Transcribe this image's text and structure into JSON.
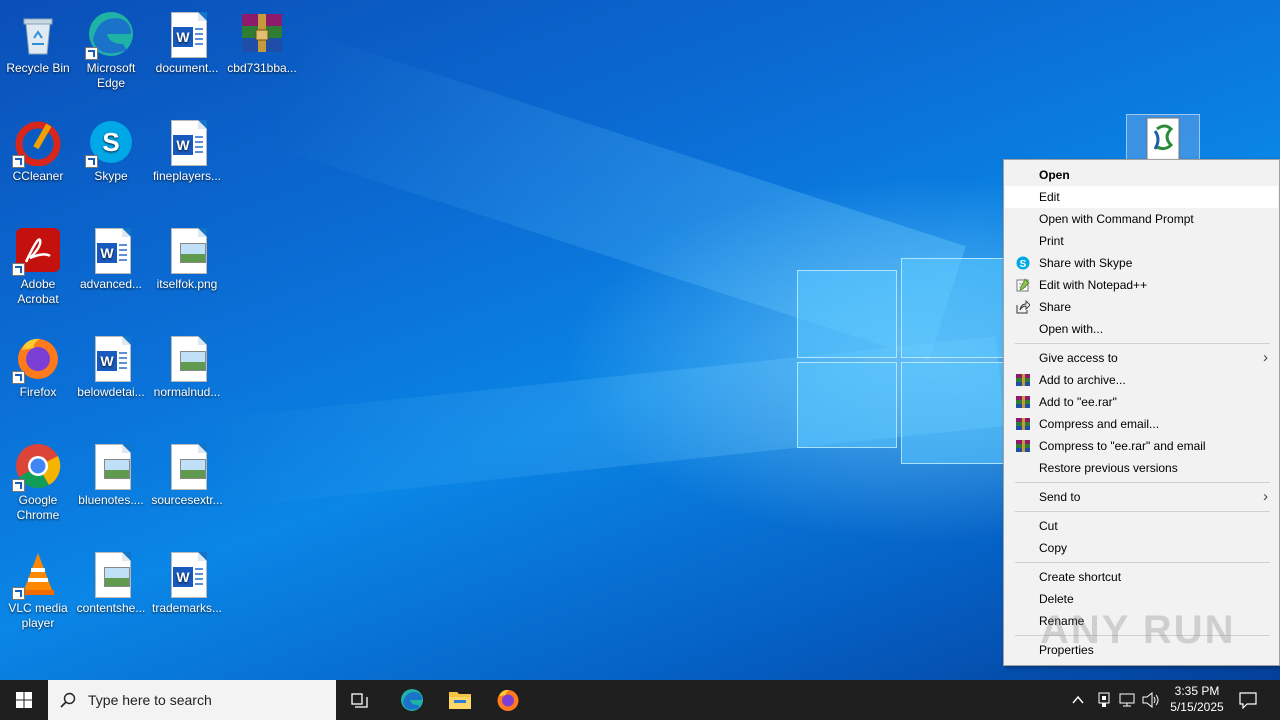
{
  "desktop_icons": [
    {
      "label": "Recycle Bin",
      "icon": "recycle-bin-icon"
    },
    {
      "label": "Microsoft Edge",
      "icon": "edge-icon"
    },
    {
      "label": "document...",
      "icon": "word-document-icon"
    },
    {
      "label": "cbd731bba...",
      "icon": "winrar-archive-icon"
    },
    {
      "label": "CCleaner",
      "icon": "ccleaner-icon"
    },
    {
      "label": "Skype",
      "icon": "skype-icon"
    },
    {
      "label": "fineplayers...",
      "icon": "word-document-icon"
    },
    {
      "label": "Adobe Acrobat",
      "icon": "acrobat-icon"
    },
    {
      "label": "advanced...",
      "icon": "word-document-icon"
    },
    {
      "label": "itselfok.png",
      "icon": "image-file-icon"
    },
    {
      "label": "Firefox",
      "icon": "firefox-icon"
    },
    {
      "label": "belowdetai...",
      "icon": "word-document-icon"
    },
    {
      "label": "normalnud...",
      "icon": "image-file-icon"
    },
    {
      "label": "Google Chrome",
      "icon": "chrome-icon"
    },
    {
      "label": "bluenotes....",
      "icon": "image-file-icon"
    },
    {
      "label": "sourcesextr...",
      "icon": "image-file-icon"
    },
    {
      "label": "VLC media player",
      "icon": "vlc-icon"
    },
    {
      "label": "contentshe...",
      "icon": "image-file-icon"
    },
    {
      "label": "trademarks...",
      "icon": "word-document-icon"
    }
  ],
  "context_menu": {
    "open": "Open",
    "edit": "Edit",
    "open_cmd": "Open with Command Prompt",
    "print": "Print",
    "share_skype": "Share with Skype",
    "edit_notepad": "Edit with Notepad++",
    "share": "Share",
    "open_with": "Open with...",
    "give_access": "Give access to",
    "add_archive": "Add to archive...",
    "add_rar": "Add to \"ee.rar\"",
    "compress_email": "Compress and email...",
    "compress_rar_email": "Compress to \"ee.rar\" and email",
    "restore": "Restore previous versions",
    "send_to": "Send to",
    "cut": "Cut",
    "copy": "Copy",
    "create_shortcut": "Create shortcut",
    "delete": "Delete",
    "rename": "Rename",
    "properties": "Properties"
  },
  "taskbar": {
    "search_placeholder": "Type here to search",
    "time": "3:35 PM",
    "date": "5/15/2025"
  },
  "watermark": "ANY RUN",
  "colors": {
    "desktop_blue": "#0a6fd6",
    "menu_bg": "#f2f2f2",
    "taskbar": "#1f1f1f",
    "word_blue": "#185abd"
  }
}
